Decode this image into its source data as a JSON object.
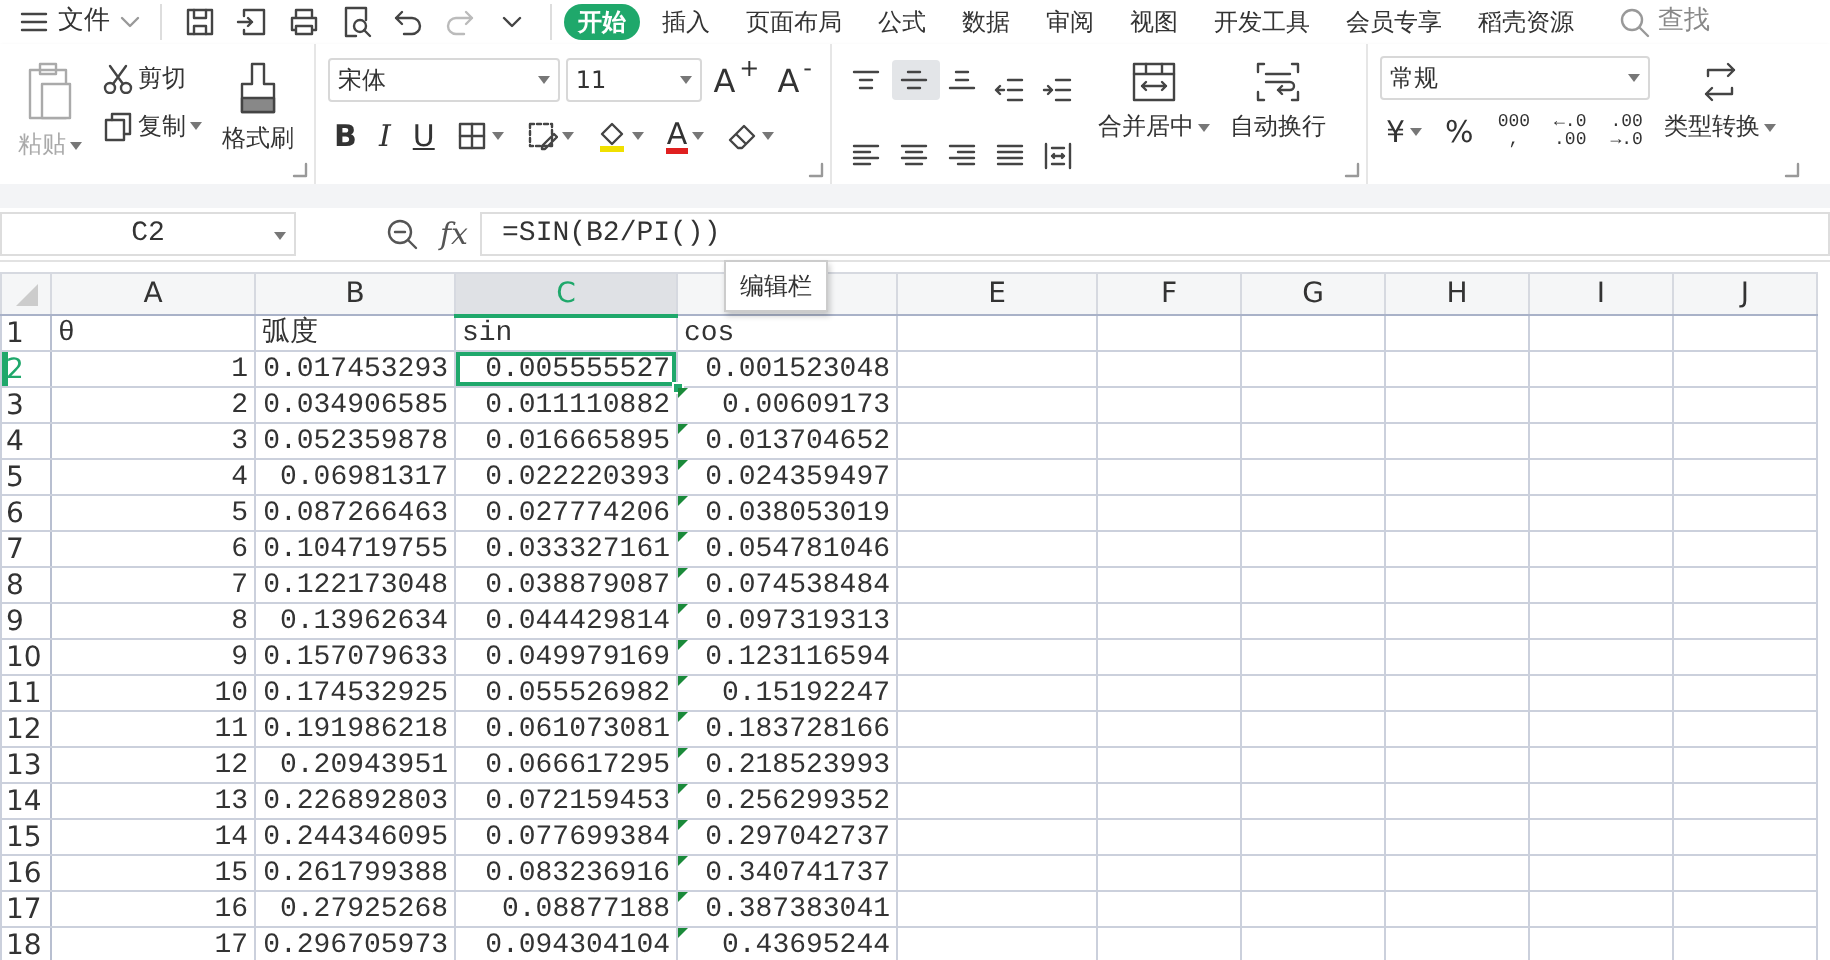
{
  "menu": {
    "label": "文件"
  },
  "tabs": [
    {
      "label": "开始",
      "selected": true
    },
    {
      "label": "插入",
      "selected": false
    },
    {
      "label": "页面布局",
      "selected": false
    },
    {
      "label": "公式",
      "selected": false
    },
    {
      "label": "数据",
      "selected": false
    },
    {
      "label": "审阅",
      "selected": false
    },
    {
      "label": "视图",
      "selected": false
    },
    {
      "label": "开发工具",
      "selected": false
    },
    {
      "label": "会员专享",
      "selected": false
    },
    {
      "label": "稻壳资源",
      "selected": false
    }
  ],
  "search": {
    "label": "查找"
  },
  "ribbon": {
    "clipboard": {
      "paste": {
        "label": "粘贴",
        "disabled": true
      },
      "cut": {
        "label": "剪切"
      },
      "copy": {
        "label": "复制"
      },
      "format_painter": {
        "label": "格式刷"
      }
    },
    "font": {
      "name": "宋体",
      "size": "11",
      "grow": "A$^{+}$",
      "shrink": "A$^{-}$",
      "bold": "B",
      "italic": "I",
      "underline": "U",
      "font_color": "A"
    },
    "alignment": {
      "vertical": [
        {
          "selected": false
        },
        {
          "selected": true
        },
        {
          "selected": false
        }
      ],
      "merge": "合并居中",
      "wrap": "自动换行"
    },
    "number": {
      "format": "常规",
      "currency": "¥",
      "percent": "%",
      "thousands": [
        "000",
        ","
      ],
      "increase_decimal": [
        "←.0",
        ".00"
      ],
      "decrease_decimal": [
        ".00",
        "→.0"
      ],
      "convert": "类型转换"
    }
  },
  "formula_bar": {
    "name_box": "C2",
    "fx": "fx",
    "formula": "=SIN(B2/PI())"
  },
  "tooltip": "编辑栏",
  "sheet": {
    "columns": [
      {
        "label": "A",
        "selected": false
      },
      {
        "label": "B",
        "selected": false
      },
      {
        "label": "C",
        "selected": true
      },
      {
        "selected": false
      },
      {
        "label": "E",
        "selected": false
      },
      {
        "label": "F",
        "selected": false
      },
      {
        "label": "G",
        "selected": false
      },
      {
        "label": "H",
        "selected": false
      },
      {
        "label": "I",
        "selected": false
      },
      {
        "label": "J",
        "selected": false
      }
    ],
    "rows": [
      {
        "header": "1",
        "kind": "text",
        "selected": false,
        "flag": false,
        "cells": [
          "θ",
          "弧度",
          "sin",
          "cos"
        ]
      },
      {
        "header": "2",
        "kind": "number",
        "selected": true,
        "flag": false,
        "cells": [
          "1",
          "0.017453293",
          "0.005555527",
          "0.001523048"
        ]
      },
      {
        "header": "3",
        "kind": "number",
        "selected": false,
        "flag": true,
        "cells": [
          "2",
          "0.034906585",
          "0.011110882",
          "0.00609173"
        ]
      },
      {
        "header": "4",
        "kind": "number",
        "selected": false,
        "flag": true,
        "cells": [
          "3",
          "0.052359878",
          "0.016665895",
          "0.013704652"
        ]
      },
      {
        "header": "5",
        "kind": "number",
        "selected": false,
        "flag": true,
        "cells": [
          "4",
          "0.06981317",
          "0.022220393",
          "0.024359497"
        ]
      },
      {
        "header": "6",
        "kind": "number",
        "selected": false,
        "flag": true,
        "cells": [
          "5",
          "0.087266463",
          "0.027774206",
          "0.038053019"
        ]
      },
      {
        "header": "7",
        "kind": "number",
        "selected": false,
        "flag": true,
        "cells": [
          "6",
          "0.104719755",
          "0.033327161",
          "0.054781046"
        ]
      },
      {
        "header": "8",
        "kind": "number",
        "selected": false,
        "flag": true,
        "cells": [
          "7",
          "0.122173048",
          "0.038879087",
          "0.074538484"
        ]
      },
      {
        "header": "9",
        "kind": "number",
        "selected": false,
        "flag": true,
        "cells": [
          "8",
          "0.13962634",
          "0.044429814",
          "0.097319313"
        ]
      },
      {
        "header": "10",
        "kind": "number",
        "selected": false,
        "flag": true,
        "cells": [
          "9",
          "0.157079633",
          "0.049979169",
          "0.123116594"
        ]
      },
      {
        "header": "11",
        "kind": "number",
        "selected": false,
        "flag": true,
        "cells": [
          "10",
          "0.174532925",
          "0.055526982",
          "0.15192247"
        ]
      },
      {
        "header": "12",
        "kind": "number",
        "selected": false,
        "flag": true,
        "cells": [
          "11",
          "0.191986218",
          "0.061073081",
          "0.183728166"
        ]
      },
      {
        "header": "13",
        "kind": "number",
        "selected": false,
        "flag": true,
        "cells": [
          "12",
          "0.20943951",
          "0.066617295",
          "0.218523993"
        ]
      },
      {
        "header": "14",
        "kind": "number",
        "selected": false,
        "flag": true,
        "cells": [
          "13",
          "0.226892803",
          "0.072159453",
          "0.256299352"
        ]
      },
      {
        "header": "15",
        "kind": "number",
        "selected": false,
        "flag": true,
        "cells": [
          "14",
          "0.244346095",
          "0.077699384",
          "0.297042737"
        ]
      },
      {
        "header": "16",
        "kind": "number",
        "selected": false,
        "flag": true,
        "cells": [
          "15",
          "0.261799388",
          "0.083236916",
          "0.340741737"
        ]
      },
      {
        "header": "17",
        "kind": "number",
        "selected": false,
        "flag": true,
        "cells": [
          "16",
          "0.27925268",
          "0.08877188",
          "0.387383041"
        ]
      },
      {
        "header": "18",
        "kind": "number",
        "selected": false,
        "flag": true,
        "cells": [
          "17",
          "0.296705973",
          "0.094304104",
          "0.43695244"
        ]
      }
    ]
  }
}
